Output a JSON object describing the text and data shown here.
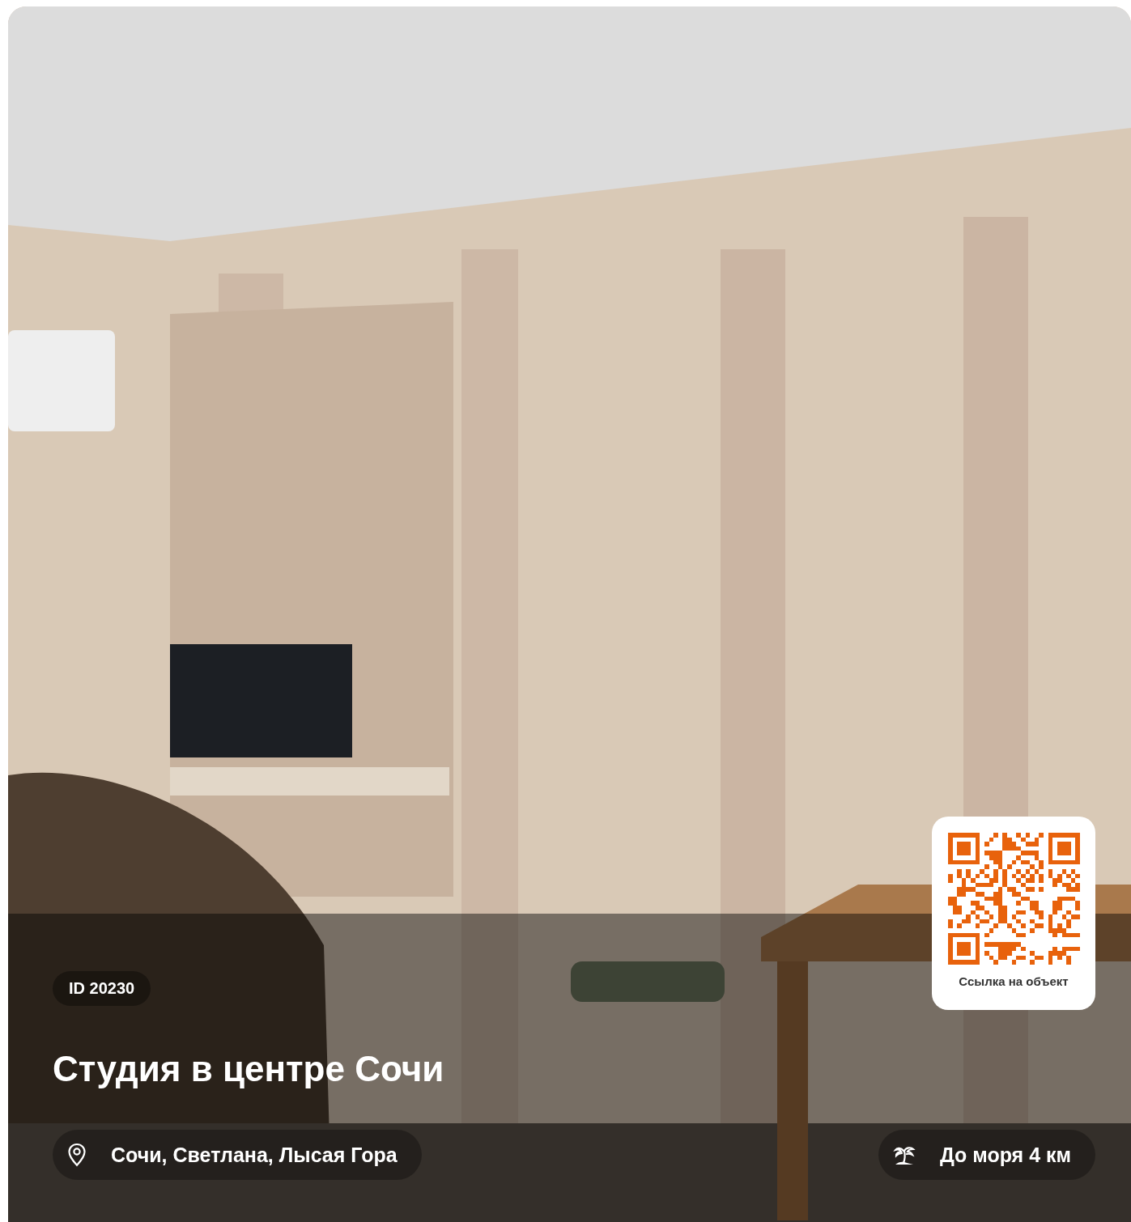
{
  "listing": {
    "id_badge": "ID 20230",
    "title": "Студия в центре Сочи",
    "location": "Сочи, Светлана, Лысая Гора",
    "sea_distance": "До моря 4 км",
    "qr": {
      "caption": "Ссылка на объект"
    }
  }
}
